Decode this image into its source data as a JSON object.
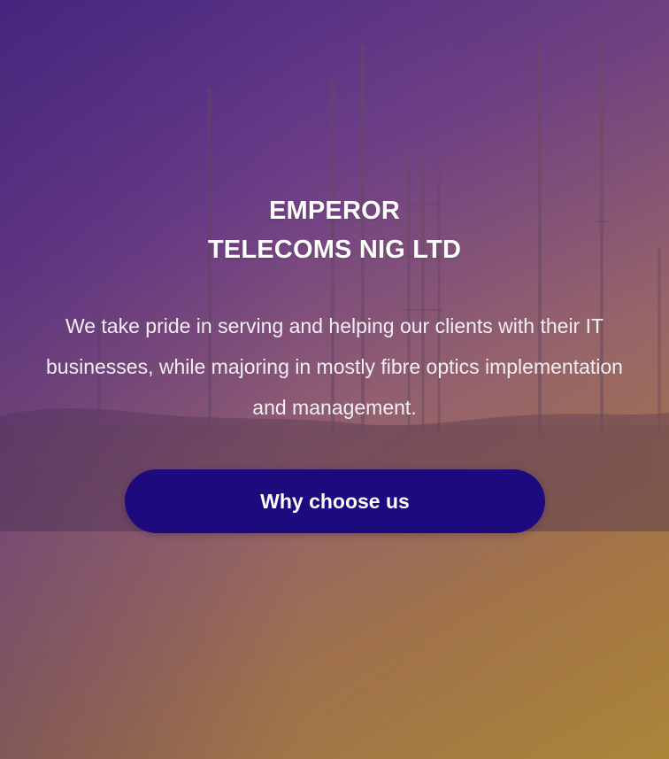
{
  "hero": {
    "title_line1": "EMPEROR",
    "title_line2": "TELECOMS NIG LTD",
    "description": "We take pride in serving and helping our clients with their IT businesses, while majoring in mostly fibre optics implementation and management.",
    "cta_label": "Why choose us"
  },
  "colors": {
    "button_bg": "#1c0a7e",
    "text": "#ffffff",
    "gradient_start": "#4a2a86",
    "gradient_end": "#b0893a"
  },
  "background": {
    "image_subject": "telecom towers at sunset"
  }
}
